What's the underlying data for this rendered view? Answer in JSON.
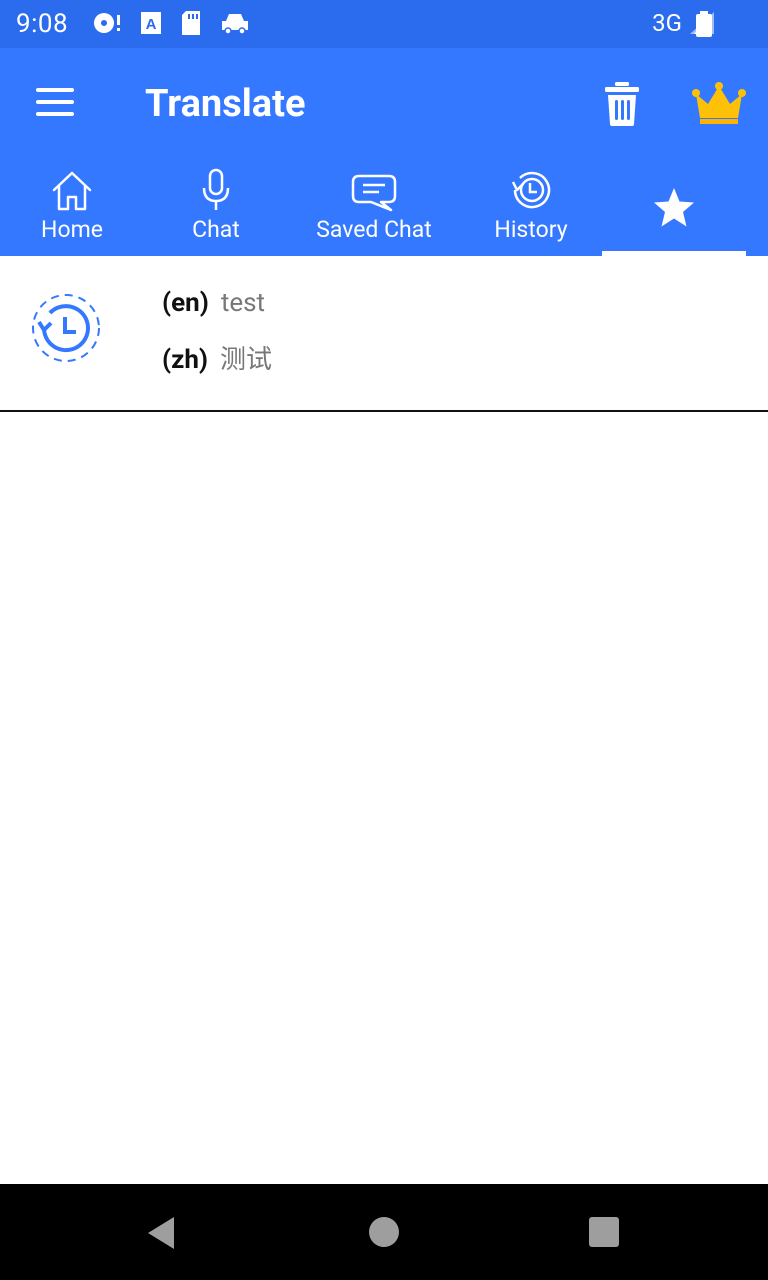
{
  "status_bar": {
    "time": "9:08",
    "network": "3G"
  },
  "app_bar": {
    "title": "Translate",
    "menu_icon": "menu-icon",
    "trash_icon": "trash-icon",
    "crown_icon": "crown-icon",
    "crown_color": "#FFC107",
    "background_color": "#3478FF"
  },
  "tabs": [
    {
      "label": "Home",
      "icon": "home-icon"
    },
    {
      "label": "Chat",
      "icon": "microphone-icon"
    },
    {
      "label": "Saved Chat",
      "icon": "chat-bubble-icon"
    },
    {
      "label": "History",
      "icon": "history-icon"
    },
    {
      "label": "",
      "icon": "star-icon",
      "selected": true
    }
  ],
  "history_items": [
    {
      "icon": "history-clock-icon",
      "source_code": "(en)",
      "source_text": "test",
      "target_code": "(zh)",
      "target_text": "测试"
    }
  ]
}
